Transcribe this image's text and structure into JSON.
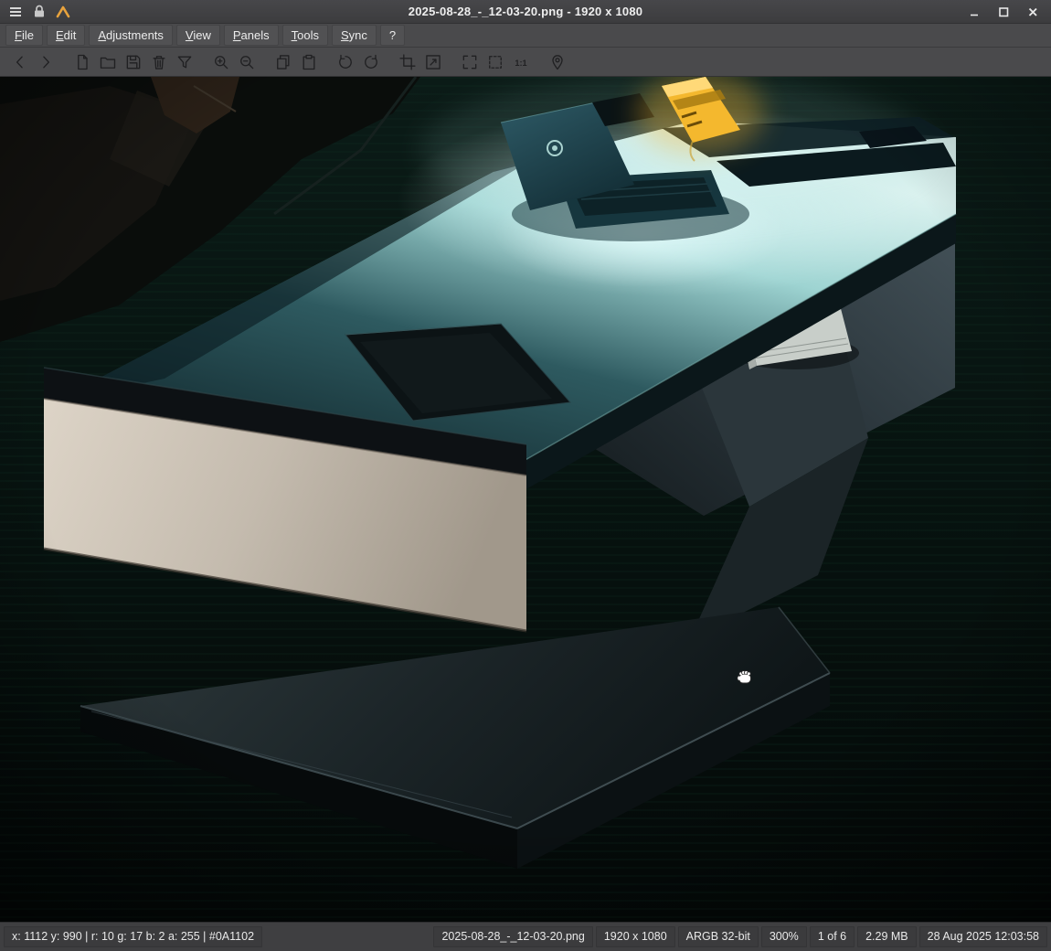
{
  "window": {
    "title": "2025-08-28_-_12-03-20.png - 1920 x 1080"
  },
  "menubar": {
    "items": [
      {
        "label": "File"
      },
      {
        "label": "Edit"
      },
      {
        "label": "Adjustments"
      },
      {
        "label": "View"
      },
      {
        "label": "Panels"
      },
      {
        "label": "Tools"
      },
      {
        "label": "Sync"
      },
      {
        "label": "?"
      }
    ]
  },
  "toolbar": {
    "actual_size_label": "1:1",
    "buttons": [
      "previous",
      "next",
      "open-file",
      "open-folder",
      "save",
      "delete",
      "filter",
      "zoom-in",
      "zoom-out",
      "copy",
      "paste",
      "rotate-ccw",
      "rotate-cw",
      "crop",
      "resize",
      "fullscreen",
      "frameless",
      "actual-size",
      "location"
    ]
  },
  "statusbar": {
    "pixel_info": "x: 1112 y: 990 | r: 10 g: 17 b: 2 a: 255 | #0A1102",
    "filename": "2025-08-28_-_12-03-20.png",
    "dimensions": "1920 x 1080",
    "color_format": "ARGB 32-bit",
    "zoom": "300%",
    "index": "1 of 6",
    "file_size": "2.29 MB",
    "modified": "28 Aug 2025 12:03:58"
  },
  "colors": {
    "logo_amber": "#e8a33d",
    "tag_yellow": "#f4b82e",
    "table_highlight": "#d9f1ee",
    "front_panel_beige": "#d9d0c3"
  }
}
